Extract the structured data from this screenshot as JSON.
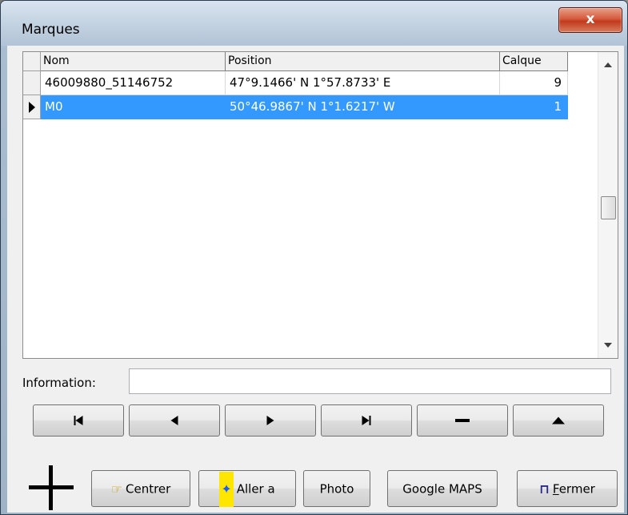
{
  "window": {
    "title": "Marques",
    "close_glyph": "x"
  },
  "grid": {
    "columns": [
      "Nom",
      "Position",
      "Calque"
    ],
    "rows": [
      {
        "nom": "46009880_51146752",
        "position": "47°9.1466' N  1°57.8733' E",
        "calque": "9",
        "selected": false
      },
      {
        "nom": "M0",
        "position": "50°46.9867' N  1°1.6217' W",
        "calque": "1",
        "selected": true
      }
    ],
    "selection_color": "#3399ff"
  },
  "info": {
    "label": "Information:",
    "value": ""
  },
  "nav_buttons": [
    {
      "name": "first-record",
      "icon": "skip-first-icon"
    },
    {
      "name": "prior-record",
      "icon": "triangle-left-icon"
    },
    {
      "name": "next-record",
      "icon": "triangle-right-icon"
    },
    {
      "name": "last-record",
      "icon": "skip-last-icon"
    },
    {
      "name": "delete-record",
      "icon": "minus-icon"
    },
    {
      "name": "edit-record",
      "icon": "triangle-up-icon"
    }
  ],
  "actions": {
    "centrer": "Centrer",
    "aller": "Aller a",
    "photo": "Photo",
    "google": "Google MAPS",
    "fermer_first": "F",
    "fermer_rest": "ermer"
  },
  "icons": {
    "crosshair": "crosshair-icon",
    "hand": "pointing-hand-icon",
    "runner": "running-man-icon",
    "door": "exit-door-icon"
  }
}
